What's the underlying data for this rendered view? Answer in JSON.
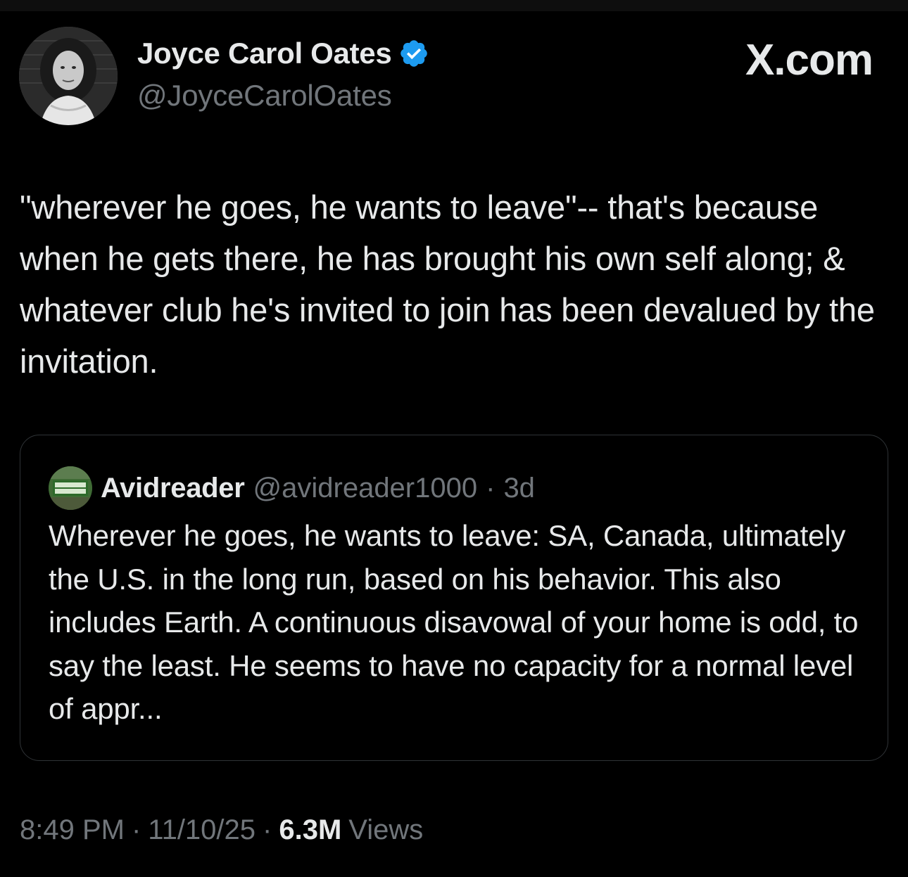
{
  "author": {
    "name": "Joyce Carol Oates",
    "handle": "@JoyceCarolOates",
    "verified_color": "#1d9bf0"
  },
  "brand": "X.com",
  "tweet": {
    "text": "\"wherever he goes, he wants to leave\"-- that's because when he gets there, he has brought his own self along; & whatever club he's invited to join has been devalued by the invitation."
  },
  "quoted": {
    "name": "Avidreader",
    "handle": "@avidreader1000",
    "separator": "·",
    "time": "3d",
    "text": "Wherever he goes, he wants to leave: SA, Canada, ultimately the U.S. in the long run, based on his behavior. This also includes Earth. A continuous disavowal of your home is odd, to say the least. He seems to have no capacity for a normal level of appr..."
  },
  "meta": {
    "time": "8:49 PM",
    "sep1": "·",
    "date": "11/10/25",
    "sep2": "·",
    "views_count": "6.3M",
    "views_label": "Views"
  },
  "colors": {
    "background": "#000000",
    "text_primary": "#e7e9ea",
    "text_secondary": "#71767b",
    "border": "#2f3336"
  }
}
